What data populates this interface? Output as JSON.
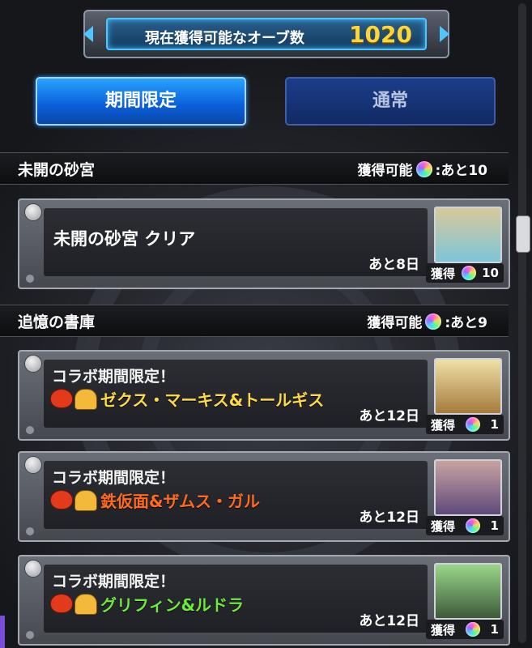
{
  "header": {
    "orb_label": "現在獲得可能なオーブ数",
    "orb_count": "1020"
  },
  "tabs": [
    {
      "label": "期間限定",
      "active": true
    },
    {
      "label": "通常",
      "active": false
    }
  ],
  "sections": [
    {
      "title": "未開の砂宮",
      "available_label": "獲得可能",
      "remaining": ":あと10",
      "quests": [
        {
          "title": "未開の砂宮 クリア",
          "remaining": "あと8日",
          "reward_label": "獲得",
          "reward_count": "10",
          "thumb_color": "#7cc6d8"
        }
      ]
    },
    {
      "title": "追憶の書庫",
      "available_label": "獲得可能",
      "remaining": ":あと9",
      "quests": [
        {
          "collab": "コラボ期間限定！",
          "name": "ゼクス・マーキス&トールギス",
          "name_color": "#ffd84a",
          "remaining": "あと12日",
          "reward_label": "獲得",
          "reward_count": "1",
          "thumb_color": "#d8b260"
        },
        {
          "collab": "コラボ期間限定！",
          "name": "鉄仮面&ザムス・ガル",
          "name_color": "#ff6a1f",
          "remaining": "あと12日",
          "reward_label": "獲得",
          "reward_count": "1",
          "thumb_color": "#8c74a8"
        },
        {
          "collab": "コラボ期間限定！",
          "name": "グリフィン&ルドラ",
          "name_color": "#6dea3a",
          "remaining": "あと12日",
          "reward_label": "獲得",
          "reward_count": "1",
          "thumb_color": "#5d9a5a"
        }
      ]
    }
  ]
}
